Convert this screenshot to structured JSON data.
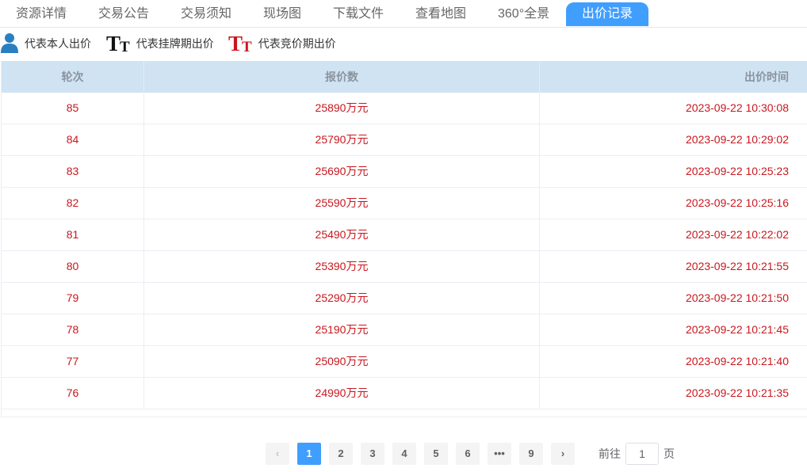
{
  "tabs": [
    {
      "label": "资源详情"
    },
    {
      "label": "交易公告"
    },
    {
      "label": "交易须知"
    },
    {
      "label": "现场图"
    },
    {
      "label": "下载文件"
    },
    {
      "label": "查看地图"
    },
    {
      "label": "360°全景"
    },
    {
      "label": "出价记录",
      "active": true
    }
  ],
  "legend": [
    {
      "label": "代表本人出价",
      "icon": "person-icon"
    },
    {
      "label": "代表挂牌期出价",
      "icon": "tt-icon",
      "icon_color": "#111111",
      "glyph_big": "T",
      "glyph_small": "T"
    },
    {
      "label": "代表竞价期出价",
      "icon": "tt-icon",
      "icon_color": "#c8171e",
      "glyph_big": "T",
      "glyph_small": "T"
    }
  ],
  "table": {
    "headers": [
      "轮次",
      "报价数",
      "出价时间"
    ],
    "rows": [
      [
        "85",
        "25890万元",
        "2023-09-22 10:30:08"
      ],
      [
        "84",
        "25790万元",
        "2023-09-22 10:29:02"
      ],
      [
        "83",
        "25690万元",
        "2023-09-22 10:25:23"
      ],
      [
        "82",
        "25590万元",
        "2023-09-22 10:25:16"
      ],
      [
        "81",
        "25490万元",
        "2023-09-22 10:22:02"
      ],
      [
        "80",
        "25390万元",
        "2023-09-22 10:21:55"
      ],
      [
        "79",
        "25290万元",
        "2023-09-22 10:21:50"
      ],
      [
        "78",
        "25190万元",
        "2023-09-22 10:21:45"
      ],
      [
        "77",
        "25090万元",
        "2023-09-22 10:21:40"
      ],
      [
        "76",
        "24990万元",
        "2023-09-22 10:21:35"
      ]
    ]
  },
  "pagination": {
    "prev": "‹",
    "next": "›",
    "pages": [
      "1",
      "2",
      "3",
      "4",
      "5",
      "6",
      "•••",
      "9"
    ],
    "current": "1",
    "goto_label": "前往",
    "goto_value": "1",
    "page_unit": "页"
  },
  "colors": {
    "accent": "#409eff",
    "bid_text": "#c8171e",
    "header_bg": "#cfe3f3",
    "person_icon": "#2a7fc1"
  }
}
